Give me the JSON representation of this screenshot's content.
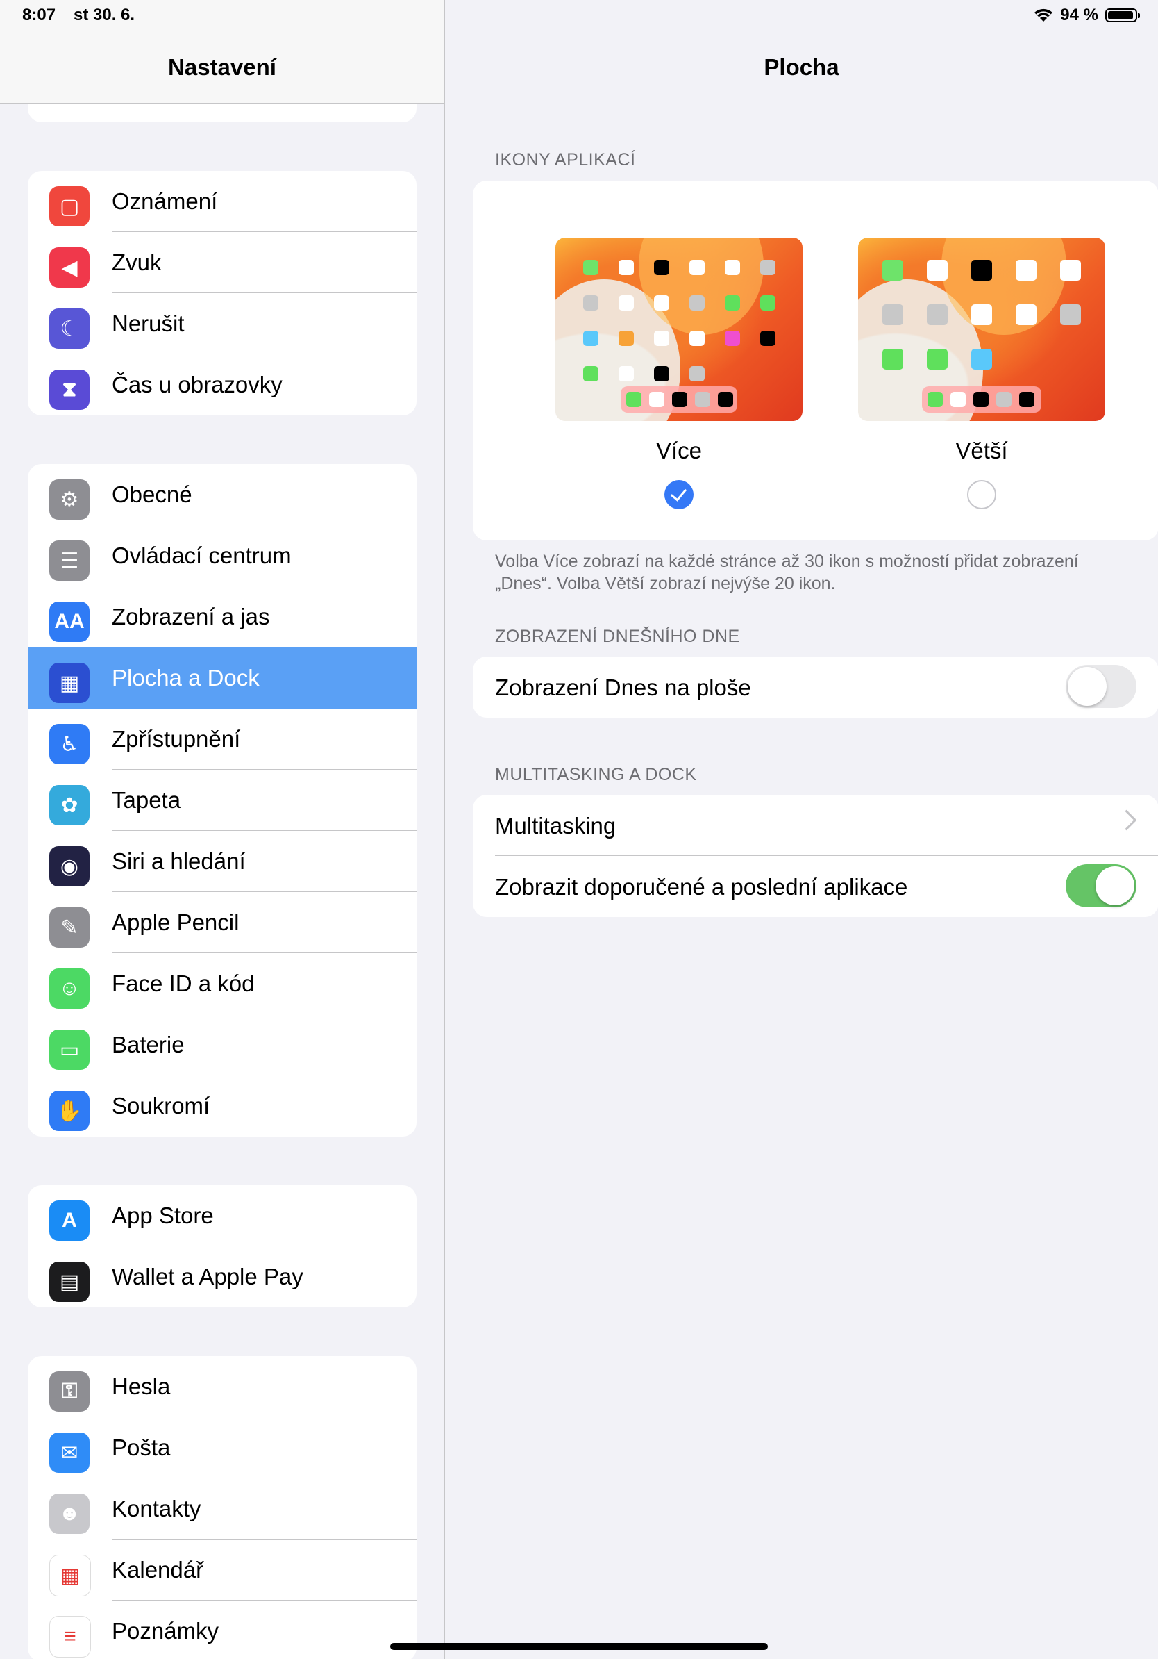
{
  "status": {
    "time": "8:07",
    "date": "st 30. 6.",
    "battery": "94 %",
    "battery_level": 0.94
  },
  "sidebar": {
    "title": "Nastavení",
    "groups": [
      [
        {
          "label": "Oznámení",
          "icon": "notifications-icon",
          "color": "#f0473d"
        },
        {
          "label": "Zvuk",
          "icon": "sound-icon",
          "color": "#f0384b"
        },
        {
          "label": "Nerušit",
          "icon": "moon-icon",
          "color": "#5856d6"
        },
        {
          "label": "Čas u obrazovky",
          "icon": "hourglass-icon",
          "color": "#5a4bd6"
        }
      ],
      [
        {
          "label": "Obecné",
          "icon": "gear-icon",
          "color": "#8e8e93"
        },
        {
          "label": "Ovládací centrum",
          "icon": "switches-icon",
          "color": "#8e8e93"
        },
        {
          "label": "Zobrazení a jas",
          "icon": "text-size-icon",
          "color": "#2f7bf5"
        },
        {
          "label": "Plocha a Dock",
          "icon": "home-grid-icon",
          "color": "#2b4fd1"
        },
        {
          "label": "Zpřístupnění",
          "icon": "accessibility-icon",
          "color": "#2f7bf5"
        },
        {
          "label": "Tapeta",
          "icon": "flower-icon",
          "color": "#34aadc"
        },
        {
          "label": "Siri a hledání",
          "icon": "siri-icon",
          "color": "#222244"
        },
        {
          "label": "Apple Pencil",
          "icon": "pencil-icon",
          "color": "#8e8e93"
        },
        {
          "label": "Face ID a kód",
          "icon": "face-id-icon",
          "color": "#4cd964"
        },
        {
          "label": "Baterie",
          "icon": "battery-icon",
          "color": "#4cd964"
        },
        {
          "label": "Soukromí",
          "icon": "hand-icon",
          "color": "#2f7bf5"
        }
      ],
      [
        {
          "label": "App Store",
          "icon": "app-store-icon",
          "color": "#1a8cf5"
        },
        {
          "label": "Wallet a Apple Pay",
          "icon": "wallet-icon",
          "color": "#1c1c1e"
        }
      ],
      [
        {
          "label": "Hesla",
          "icon": "key-icon",
          "color": "#8e8e93"
        },
        {
          "label": "Pošta",
          "icon": "mail-icon",
          "color": "#2f8cf7"
        },
        {
          "label": "Kontakty",
          "icon": "contacts-icon",
          "color": "#c8c8cc"
        },
        {
          "label": "Kalendář",
          "icon": "calendar-icon",
          "color": "#ffffff"
        },
        {
          "label": "Poznámky",
          "icon": "notes-icon",
          "color": "#ffffff"
        }
      ]
    ],
    "selected": "Plocha a Dock"
  },
  "detail": {
    "title": "Plocha",
    "icons_header": "IKONY APLIKACÍ",
    "option_more": "Více",
    "option_bigger": "Větší",
    "icons_footnote": "Volba Více zobrazí na každé stránce až 30 ikon s možností přidat zobrazení „Dnes“. Volba Větší zobrazí nejvýše 20 ikon.",
    "today_header": "ZOBRAZENÍ DNEŠNÍHO DNE",
    "today_row": "Zobrazení Dnes na ploše",
    "today_on": false,
    "multitask_header": "MULTITASKING A DOCK",
    "multitasking_row": "Multitasking",
    "suggested_row": "Zobrazit doporučené a poslední aplikace",
    "suggested_on": true
  }
}
